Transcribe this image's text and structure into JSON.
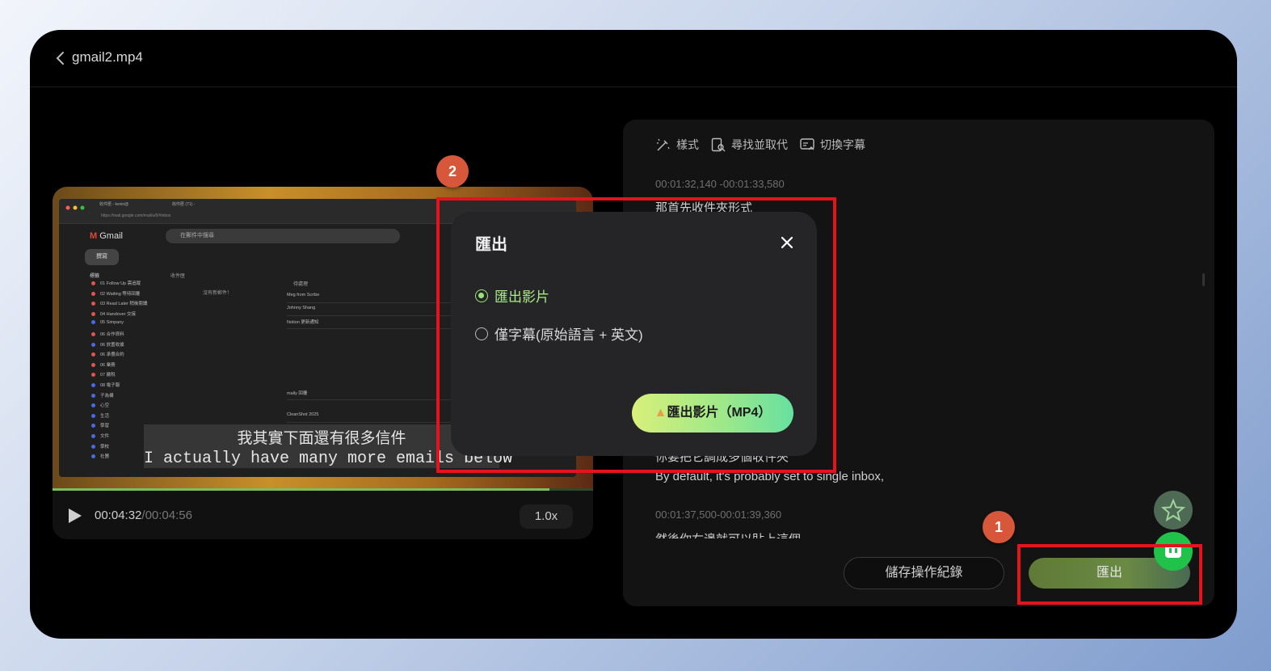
{
  "header": {
    "filename": "gmail2.mp4"
  },
  "video": {
    "browser": {
      "tab1": "收件匣 - kevin@",
      "tab2": "收件匣 (71) - ",
      "url": "https://mail.google.com/mail/u/0/#inbox"
    },
    "gmail": {
      "brand": "Gmail",
      "search_placeholder": "在郵件中搜尋",
      "compose": "撰寫",
      "labels_header": "標籤",
      "labels": [
        "01 Follow Up 需追蹤",
        "02 Waiting 等待回覆",
        "03 Read Later 稍後閱讀",
        "04 Handover 交接",
        "05 Simpany",
        "06 合作資料",
        "06 放置收據",
        "06 承攬合約",
        "06 業務",
        "07 繳稅",
        "08 電子報",
        "子為構",
        "心空",
        "生活",
        "學習",
        "文件",
        "學校",
        "社團"
      ],
      "inbox_label": "收件匣",
      "no_mail": "沒有新郵件！",
      "todo_label": "待處理",
      "rows": [
        "Meg from Scribe",
        "Johnny Shang",
        "Notion 更新通知",
        "mally 回覆",
        "CleanShot 2025"
      ]
    },
    "subtitle_zh": "我其實下面還有很多信件",
    "subtitle_en": "I actually have many more emails below",
    "current_time": "00:04:32",
    "separator": "/",
    "duration": "00:04:56",
    "speed": "1.0x",
    "progress_percent": 92
  },
  "panel": {
    "tools": {
      "style": "樣式",
      "find_replace": "尋找並取代",
      "switch_subtitle": "切換字幕"
    },
    "entries": [
      {
        "timestamp": "00:01:32,140 -00:01:33,580",
        "text": "那首先收件夾形式"
      },
      {
        "timestamp": "",
        "text": "你要把它調成多個收件夾"
      },
      {
        "timestamp": "",
        "text": "By default, it's probably set to single inbox,"
      },
      {
        "timestamp": "00:01:37,500-00:01:39,360",
        "text": "然後你右邊就可以貼上這個"
      }
    ],
    "save_button": "儲存操作紀錄",
    "export_button": "匯出"
  },
  "dialog": {
    "title": "匯出",
    "option_video": "匯出影片",
    "option_subtitles": "僅字幕(原始語言 + 英文)",
    "selected": "匯出影片",
    "submit": "匯出影片（MP4）"
  },
  "annotations": {
    "badge1": "1",
    "badge2": "2"
  },
  "colors": {
    "accent": "#9be27a",
    "annotation_red": "#e3141b",
    "badge": "#d7573b"
  }
}
